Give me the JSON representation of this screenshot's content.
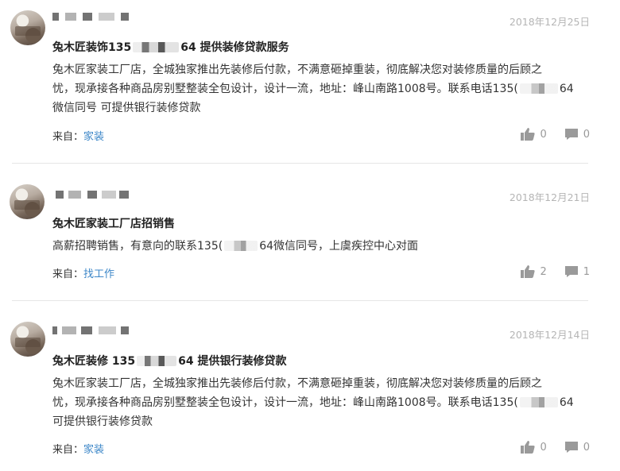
{
  "posts": [
    {
      "date": "2018年12月25日",
      "title_prefix": "兔木匠装饰135",
      "title_suffix": "64 提供装修贷款服务",
      "body_lines": [
        "兔木匠家装工厂店，全城独家推出先装修后付款，不满意砸掉重装，彻底解决您对装修质量的后顾之",
        "忧，现承接各种商品房别墅整装全包设计，设计一流，地址：峰山南路1008号。联系电话135(",
        "微信同号 可提供银行装修贷款"
      ],
      "phone_tail": "64",
      "source_label": "来自：",
      "source_tag": "家装",
      "likes": "0",
      "comments": "0"
    },
    {
      "date": "2018年12月21日",
      "title": "兔木匠家装工厂店招销售",
      "body_prefix": "高薪招聘销售，有意向的联系135(",
      "body_suffix": "64微信同号，上虞疾控中心对面",
      "source_label": "来自：",
      "source_tag": "找工作",
      "likes": "2",
      "comments": "1"
    },
    {
      "date": "2018年12月14日",
      "title_prefix": "兔木匠装修 135",
      "title_suffix": "64 提供银行装修贷款",
      "body_lines": [
        "兔木匠家装工厂店，全城独家推出先装修后付款，不满意砸掉重装，彻底解决您对装修质量的后顾之",
        "忧，现承接各种商品房别墅整装全包设计，设计一流，地址：峰山南路1008号。联系电话135(",
        "可提供银行装修贷款"
      ],
      "phone_tail": "64",
      "source_label": "来自：",
      "source_tag": "家装",
      "likes": "0",
      "comments": "0"
    }
  ],
  "icons": {
    "like": "thumbs-up-icon",
    "comment": "comment-icon"
  },
  "colors": {
    "link": "#3d87c8",
    "date": "#b5b5b5",
    "meta": "#999999"
  }
}
